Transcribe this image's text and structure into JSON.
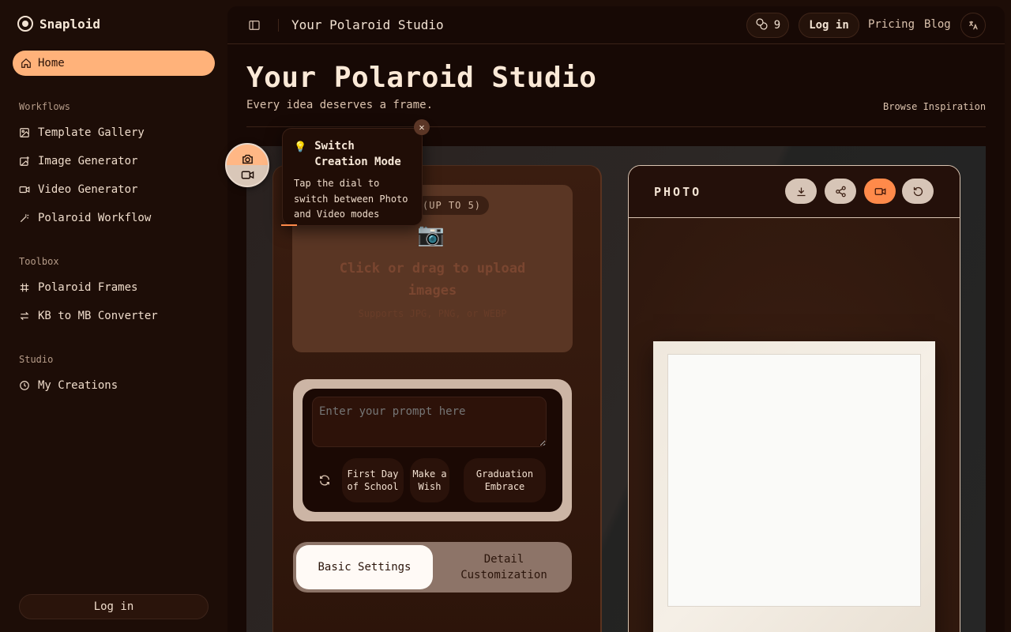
{
  "brand": {
    "name": "Snaploid"
  },
  "sidebar": {
    "home": "Home",
    "sections": [
      {
        "title": "Workflows",
        "items": [
          "Template Gallery",
          "Image Generator",
          "Video Generator",
          "Polaroid Workflow"
        ]
      },
      {
        "title": "Toolbox",
        "items": [
          "Polaroid Frames",
          "KB to MB Converter"
        ]
      },
      {
        "title": "Studio",
        "items": [
          "My Creations"
        ]
      }
    ],
    "login": "Log in"
  },
  "topbar": {
    "title": "Your Polaroid Studio",
    "credits": "9",
    "login": "Log in",
    "pricing": "Pricing",
    "blog": "Blog",
    "lang_icon": "translate-icon"
  },
  "page": {
    "title": "Your Polaroid Studio",
    "subtitle": "Every idea deserves a frame.",
    "browse": "Browse Inspiration"
  },
  "upload": {
    "pill": "(UP TO 5)",
    "cam": "📷",
    "text": "Click or drag to upload images",
    "hint": "Supports JPG, PNG, or WEBP"
  },
  "prompt": {
    "placeholder": "Enter your prompt here",
    "chips": [
      "First Day of School",
      "Make a Wish",
      "Graduation Embrace"
    ]
  },
  "tabs": {
    "basic": "Basic Settings",
    "detail": "Detail Customization"
  },
  "preview": {
    "title": "PHOTO"
  },
  "tooltip": {
    "title": "Switch Creation Mode",
    "body": "Tap the dial to switch between Photo and Video modes",
    "close": "✕",
    "bulb": "💡"
  },
  "colors": {
    "accent": "#ffb27a",
    "active": "#ff8a4a",
    "background": "#1d0d07"
  }
}
